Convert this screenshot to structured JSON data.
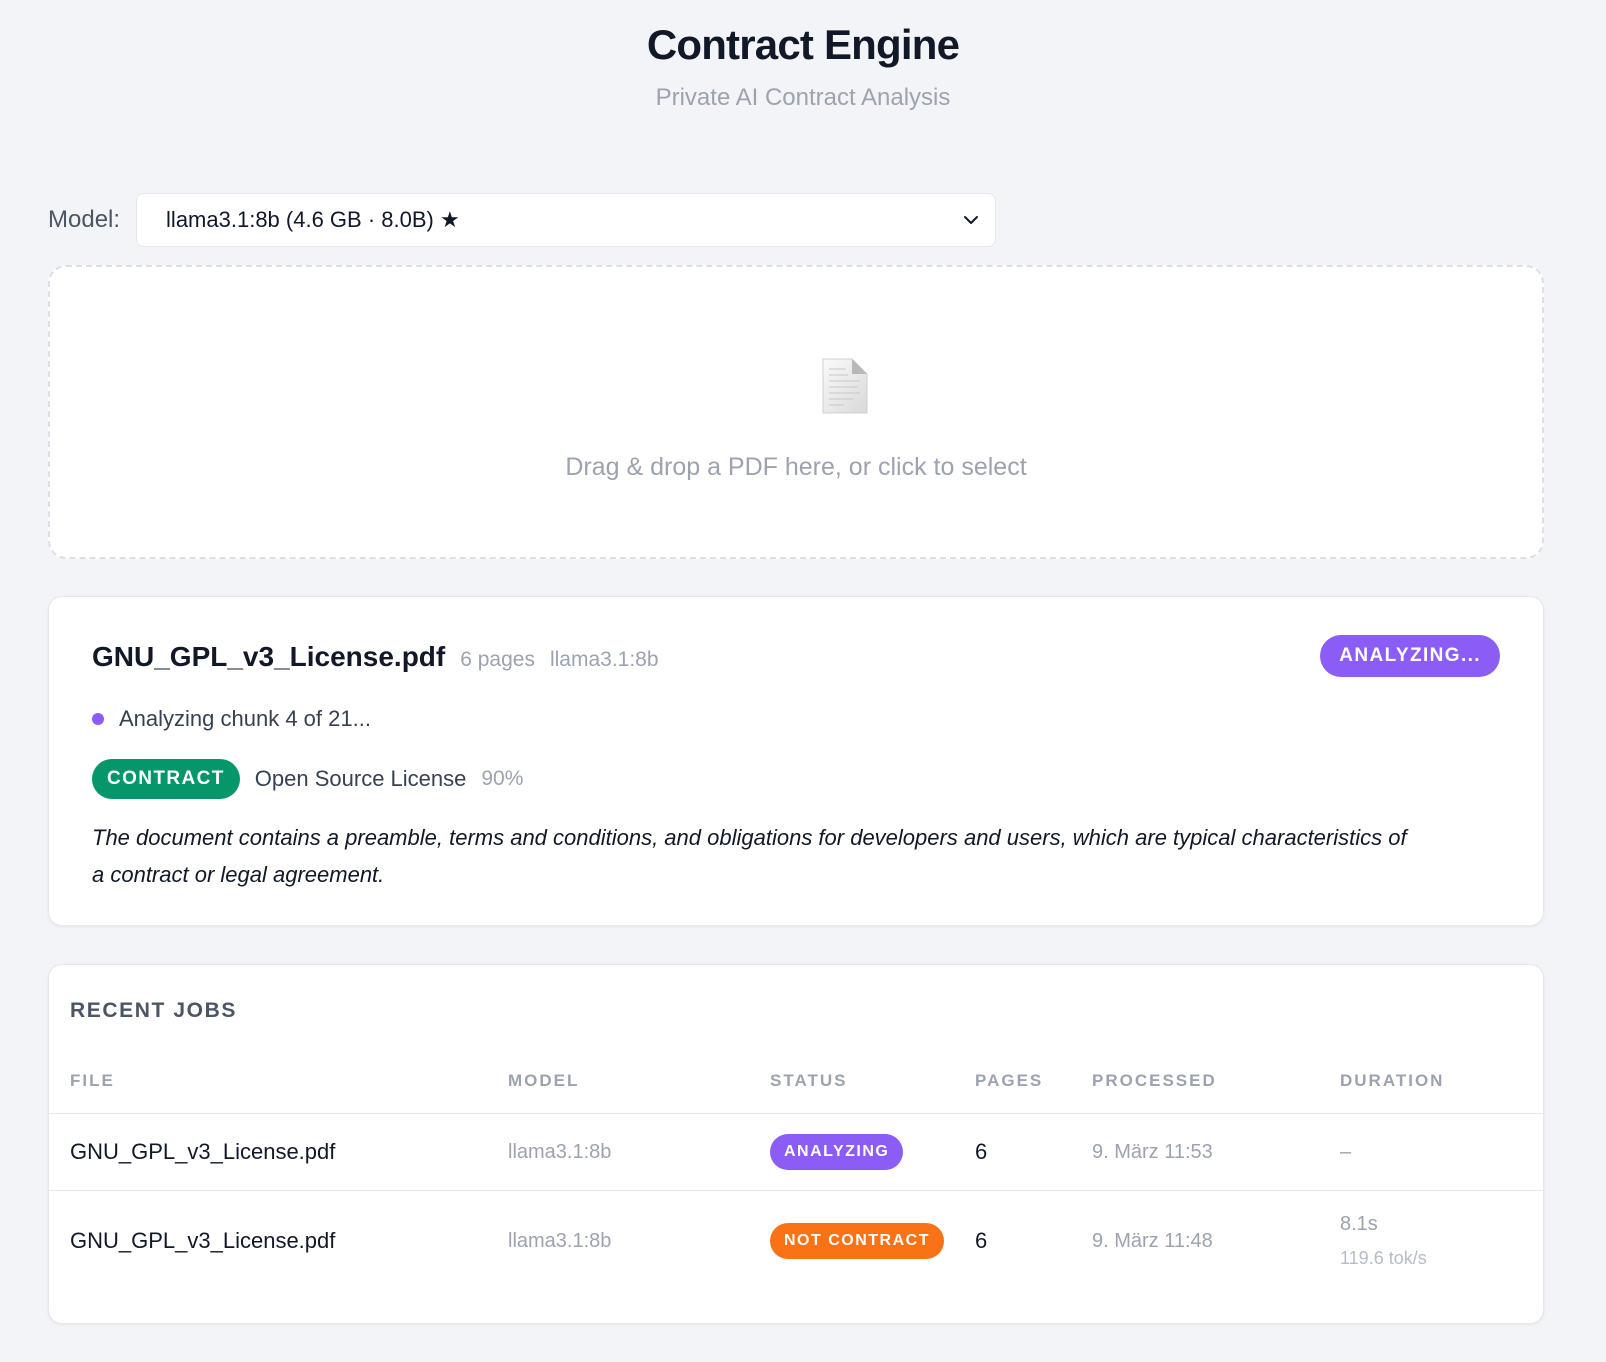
{
  "app": {
    "title": "Contract Engine",
    "subtitle": "Private AI Contract Analysis"
  },
  "model_selector": {
    "label": "Model:",
    "selected": "llama3.1:8b (4.6 GB · 8.0B) ★"
  },
  "dropzone": {
    "text": "Drag & drop a PDF here, or click to select",
    "icon": "document-icon"
  },
  "current_job": {
    "file": "GNU_GPL_v3_License.pdf",
    "pages": "6 pages",
    "model": "llama3.1:8b",
    "status": "ANALYZING...",
    "progress": "Analyzing chunk 4 of 21...",
    "classification_badge": "CONTRACT",
    "classification_type": "Open Source License",
    "confidence": "90%",
    "reasoning": "The document contains a preamble, terms and conditions, and obligations for developers and users, which are typical characteristics of a contract or legal agreement."
  },
  "recent_jobs": {
    "title": "RECENT JOBS",
    "columns": {
      "file": "FILE",
      "model": "MODEL",
      "status": "STATUS",
      "pages": "PAGES",
      "processed": "PROCESSED",
      "duration": "DURATION"
    },
    "rows": [
      {
        "file": "GNU_GPL_v3_License.pdf",
        "model": "llama3.1:8b",
        "status": "ANALYZING",
        "pages": "6",
        "processed": "9. März 11:53",
        "duration": "–",
        "speed": ""
      },
      {
        "file": "GNU_GPL_v3_License.pdf",
        "model": "llama3.1:8b",
        "status": "NOT CONTRACT",
        "pages": "6",
        "processed": "9. März 11:48",
        "duration": "8.1s",
        "speed": "119.6 tok/s"
      }
    ]
  },
  "colors": {
    "background": "#f3f4f7",
    "analyzing": "#8b5cf6",
    "contract": "#059669",
    "not_contract": "#f97316"
  }
}
